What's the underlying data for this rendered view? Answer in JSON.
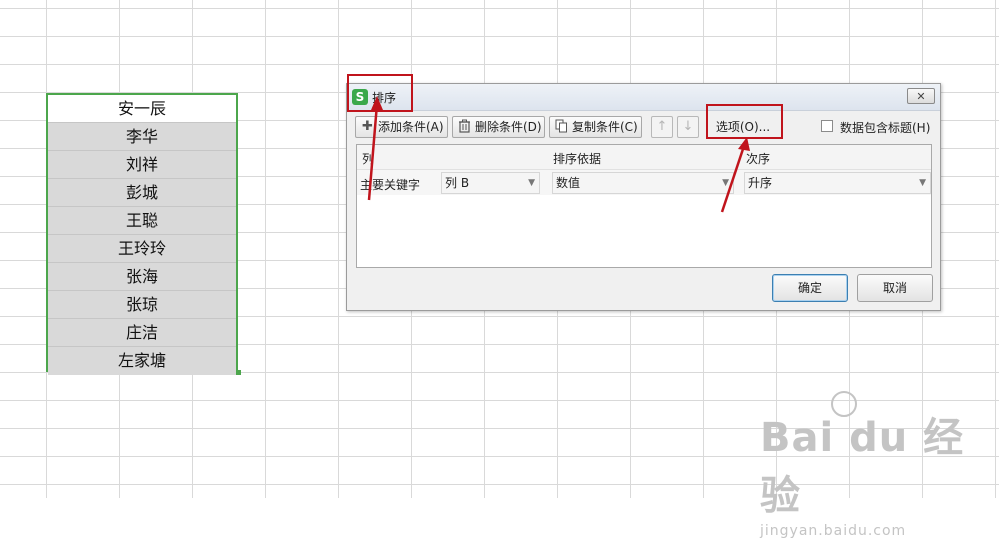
{
  "sheet": {
    "names": [
      "安一辰",
      "李华",
      "刘祥",
      "彭城",
      "王聪",
      "王玲玲",
      "张海",
      "张琼",
      "庄洁",
      "左家塘"
    ]
  },
  "dialog": {
    "title": "排序",
    "app_icon_letter": "S",
    "close_symbol": "✕",
    "toolbar": {
      "add_condition": "添加条件(A)",
      "delete_condition": "删除条件(D)",
      "copy_condition": "复制条件(C)",
      "move_up_symbol": "↑",
      "move_down_symbol": "↓",
      "options": "选项(O)...",
      "header_checkbox_label": "数据包含标题(H)"
    },
    "table": {
      "headers": {
        "column": "列",
        "sort_on": "排序依据",
        "order": "次序"
      },
      "row": {
        "key_label": "主要关键字",
        "column_value": "列 B",
        "sort_on_value": "数值",
        "order_value": "升序"
      }
    },
    "ok": "确定",
    "cancel": "取消"
  },
  "watermark": {
    "main": "Bai du 经验",
    "sub": "jingyan.baidu.com"
  },
  "colors": {
    "selection_border": "#4ca64c",
    "annotation": "#c0141c",
    "app_icon": "#3aa84a",
    "ok_border": "#3c7fb1"
  }
}
